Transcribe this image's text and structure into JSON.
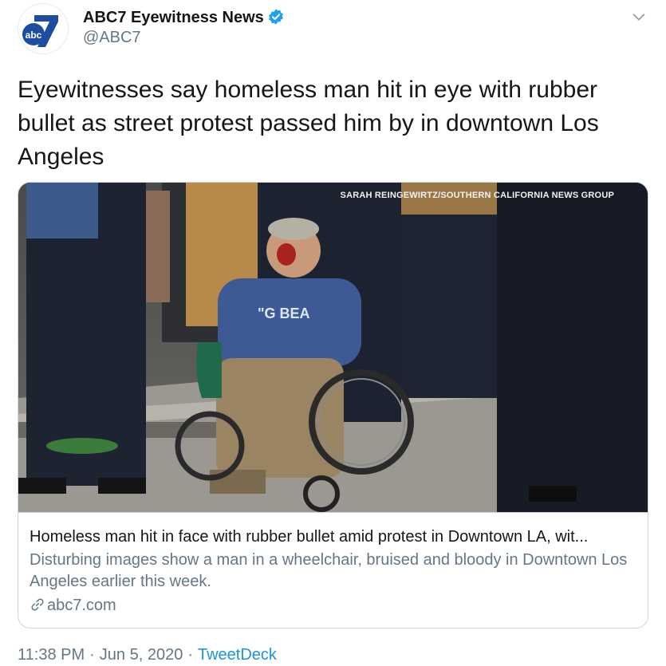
{
  "author": {
    "name": "ABC7 Eyewitness News",
    "handle": "@ABC7",
    "avatar_icon": "abc7-logo",
    "avatar_text": "abc",
    "verified_icon": "verified-badge-icon",
    "verified_color": "#1da1f2"
  },
  "tweet": {
    "text": "Eyewitnesses say homeless man hit in eye with rubber bullet as street protest passed him by in downtown Los Angeles"
  },
  "card": {
    "image_credit": "SARAH REINGEWIRTZ/SOUTHERN CALIFORNIA NEWS GROUP",
    "title": "Homeless man hit in face with rubber bullet amid protest in Downtown LA, wit...",
    "description": "Disturbing images show a man in a wheelchair, bruised and bloody in Downtown Los Angeles earlier this week.",
    "domain": "abc7.com",
    "link_icon": "link-icon"
  },
  "meta": {
    "time": "11:38 PM",
    "separator": "·",
    "date": "Jun 5, 2020",
    "source": "TweetDeck"
  },
  "colors": {
    "link_blue": "#1b95e0",
    "secondary_text": "#657786",
    "abc_blue": "#1c4da1"
  }
}
